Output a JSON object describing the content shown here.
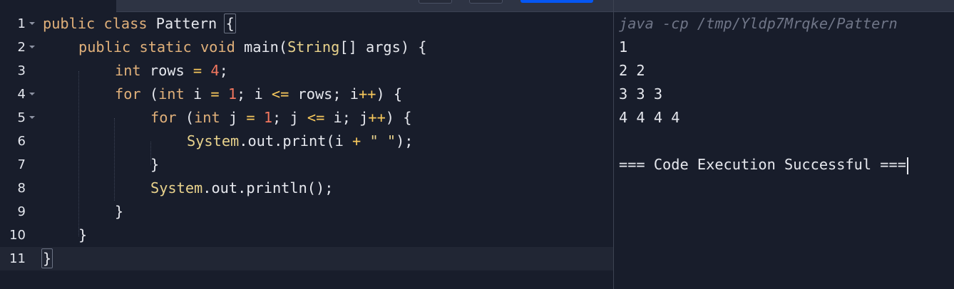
{
  "editor": {
    "line_numbers": [
      "1",
      "2",
      "3",
      "4",
      "5",
      "6",
      "7",
      "8",
      "9",
      "10",
      "11"
    ],
    "lines": {
      "l1": {
        "kw1": "public",
        "kw2": "class",
        "name": "Pattern",
        "brace": "{"
      },
      "l2": {
        "kw1": "public",
        "kw2": "static",
        "kw3": "void",
        "name": "main(",
        "type": "String",
        "rest": "[] args) {"
      },
      "l3": {
        "kw": "int",
        "a": "rows",
        "eq": "=",
        "num": "4",
        "end": ";"
      },
      "l4": {
        "kw": "for",
        "p1": "(",
        "kw2": "int",
        "a": "i",
        "eq": "=",
        "num": "1",
        "b": "; i",
        "le": "<=",
        "c": "rows; i",
        "inc": "++",
        "end": ") {"
      },
      "l5": {
        "kw": "for",
        "p1": "(",
        "kw2": "int",
        "a": "j",
        "eq": "=",
        "num": "1",
        "b": "; j",
        "le": "<=",
        "c": "i; j",
        "inc": "++",
        "end": ") {"
      },
      "l6": {
        "cls": "System",
        "a": ".out.print(i",
        "plus": "+",
        "str": "\" \"",
        "end": ");"
      },
      "l7": {
        "text": "}"
      },
      "l8": {
        "cls": "System",
        "a": ".out.println();"
      },
      "l9": {
        "text": "}"
      },
      "l10": {
        "text": "}"
      },
      "l11": {
        "brace": "}"
      }
    }
  },
  "output": {
    "command": "java -cp /tmp/Yldp7Mrqke/Pattern",
    "rows": [
      "1",
      "2 2",
      "3 3 3",
      "4 4 4 4"
    ],
    "status": "=== Code Execution Successful ==="
  },
  "colors": {
    "background": "#181d2b",
    "keyword": "#e0b07a",
    "number": "#f3775f",
    "operator": "#f7c85c",
    "class": "#e8d28c",
    "run_button": "#0556f3"
  }
}
